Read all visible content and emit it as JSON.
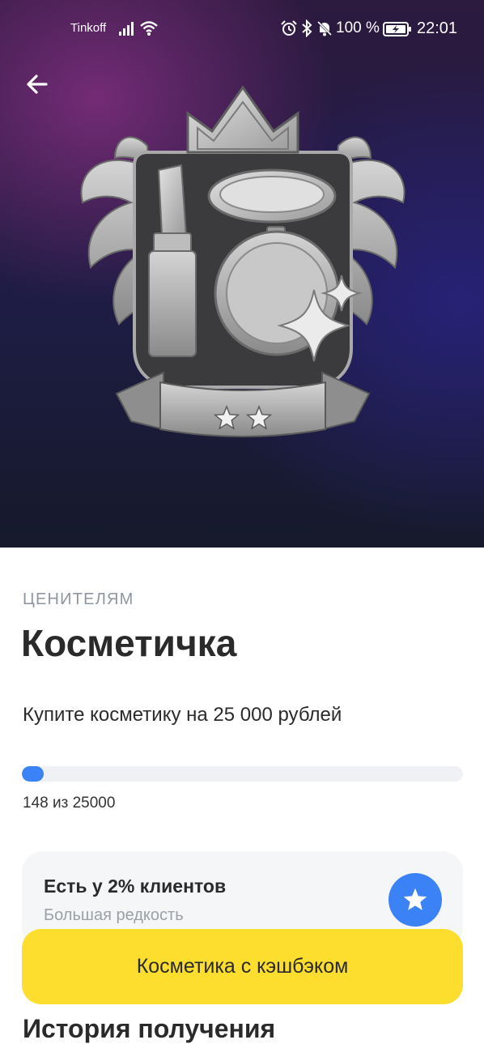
{
  "status_bar": {
    "carrier": "Tinkoff",
    "battery": "100 %",
    "time": "22:01"
  },
  "icons": {
    "back": "arrow-left-icon",
    "signal": "signal-bars-icon",
    "wifi": "wifi-icon",
    "alarm": "alarm-clock-icon",
    "bluetooth": "bluetooth-icon",
    "mute": "bell-muted-icon",
    "battery": "battery-charging-icon",
    "rarity": "star-icon"
  },
  "colors": {
    "accent_blue": "#3c82f7",
    "button_yellow": "#fddd2d",
    "hero_purple": "#782c78",
    "hero_navy": "#1e1c45"
  },
  "achievement": {
    "category": "ЦЕНИТЕЛЯМ",
    "title": "Косметичка",
    "description": "Купите косметику на 25 000 рублей",
    "progress": {
      "current": 148,
      "target": 25000,
      "label": "148 из 25000"
    },
    "badge_stars": 2
  },
  "rarity": {
    "title": "Есть у 2% клиентов",
    "subtitle": "Большая редкость"
  },
  "history": {
    "title": "История получения"
  },
  "cta": {
    "label": "Косметика с кэшбэком"
  }
}
